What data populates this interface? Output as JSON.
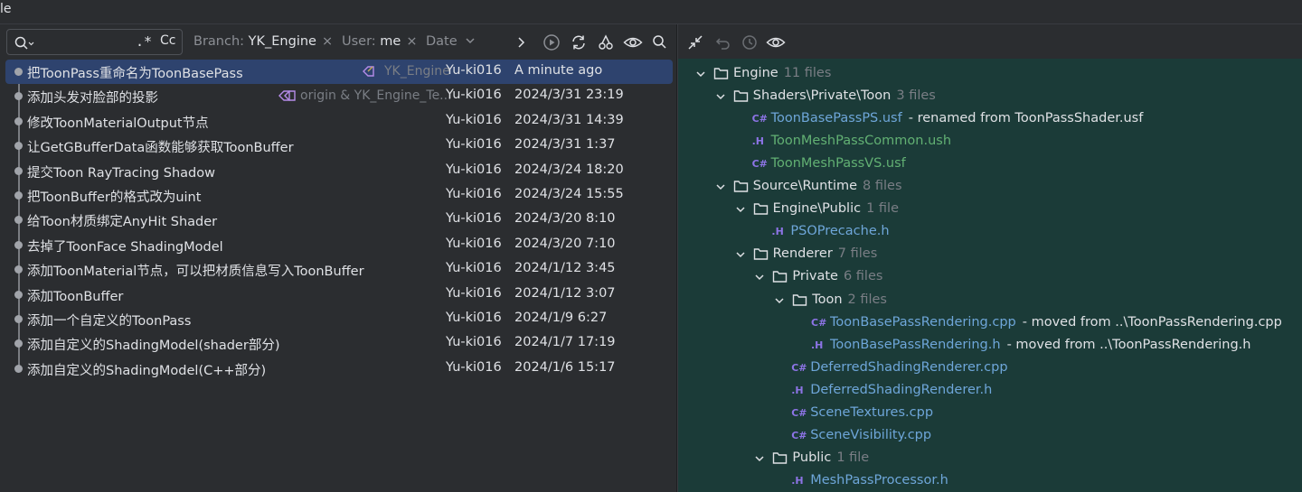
{
  "window": {
    "title": "le"
  },
  "search": {
    "placeholder": "",
    "regex_label": ".*",
    "case_label": "Cc"
  },
  "filters": {
    "branch": {
      "label": "Branch:",
      "value": "YK_Engine",
      "clear": "×"
    },
    "user": {
      "label": "User:",
      "value": "me",
      "clear": "×"
    },
    "date": {
      "label": "Date"
    }
  },
  "commits": [
    {
      "message": "把ToonPass重命名为ToonBasePass",
      "tag": "YK_Engine",
      "author": "Yu-ki016",
      "date": "A minute ago",
      "selected": true
    },
    {
      "message": "添加头发对脸部的投影",
      "tag": "origin & YK_Engine_Te...",
      "author": "Yu-ki016",
      "date": "2024/3/31 23:19"
    },
    {
      "message": "修改ToonMaterialOutput节点",
      "author": "Yu-ki016",
      "date": "2024/3/31 14:39"
    },
    {
      "message": "让GetGBufferData函数能够获取ToonBuffer",
      "author": "Yu-ki016",
      "date": "2024/3/31 1:37"
    },
    {
      "message": "提交Toon RayTracing Shadow",
      "author": "Yu-ki016",
      "date": "2024/3/24 18:20"
    },
    {
      "message": "把ToonBuffer的格式改为uint",
      "author": "Yu-ki016",
      "date": "2024/3/24 15:55"
    },
    {
      "message": "给Toon材质绑定AnyHit Shader",
      "author": "Yu-ki016",
      "date": "2024/3/20 8:10"
    },
    {
      "message": "去掉了ToonFace ShadingModel",
      "author": "Yu-ki016",
      "date": "2024/3/20 7:10"
    },
    {
      "message": "添加ToonMaterial节点，可以把材质信息写入ToonBuffer",
      "author": "Yu-ki016",
      "date": "2024/1/12 3:45"
    },
    {
      "message": "添加ToonBuffer",
      "author": "Yu-ki016",
      "date": "2024/1/12 3:07"
    },
    {
      "message": "添加一个自定义的ToonPass",
      "author": "Yu-ki016",
      "date": "2024/1/9 6:27"
    },
    {
      "message": "添加自定义的ShadingModel(shader部分)",
      "author": "Yu-ki016",
      "date": "2024/1/7 17:19"
    },
    {
      "message": "添加自定义的ShadingModel(C++部分)",
      "author": "Yu-ki016",
      "date": "2024/1/6 15:17"
    }
  ],
  "tree": [
    {
      "type": "folder",
      "name": "Engine",
      "count": "11 files",
      "depth": 0
    },
    {
      "type": "folder",
      "name": "Shaders\\Private\\Toon",
      "count": "3 files",
      "depth": 1
    },
    {
      "type": "file",
      "icon": "C#",
      "name": "ToonBasePassPS.usf",
      "status": "modified",
      "note": "- renamed from ToonPassShader.usf",
      "depth": 2
    },
    {
      "type": "file",
      "icon": ".H",
      "name": "ToonMeshPassCommon.ush",
      "status": "added",
      "depth": 2
    },
    {
      "type": "file",
      "icon": "C#",
      "name": "ToonMeshPassVS.usf",
      "status": "added",
      "depth": 2
    },
    {
      "type": "folder",
      "name": "Source\\Runtime",
      "count": "8 files",
      "depth": 1
    },
    {
      "type": "folder",
      "name": "Engine\\Public",
      "count": "1 file",
      "depth": 2
    },
    {
      "type": "file",
      "icon": ".H",
      "name": "PSOPrecache.h",
      "status": "modified",
      "depth": 3
    },
    {
      "type": "folder",
      "name": "Renderer",
      "count": "7 files",
      "depth": 2
    },
    {
      "type": "folder",
      "name": "Private",
      "count": "6 files",
      "depth": 3
    },
    {
      "type": "folder",
      "name": "Toon",
      "count": "2 files",
      "depth": 4
    },
    {
      "type": "file",
      "icon": "C#",
      "name": "ToonBasePassRendering.cpp",
      "status": "modified",
      "note": "- moved from ..\\ToonPassRendering.cpp",
      "depth": 5
    },
    {
      "type": "file",
      "icon": ".H",
      "name": "ToonBasePassRendering.h",
      "status": "modified",
      "note": "- moved from ..\\ToonPassRendering.h",
      "depth": 5
    },
    {
      "type": "file",
      "icon": "C#",
      "name": "DeferredShadingRenderer.cpp",
      "status": "modified",
      "depth": 4
    },
    {
      "type": "file",
      "icon": ".H",
      "name": "DeferredShadingRenderer.h",
      "status": "modified",
      "depth": 4
    },
    {
      "type": "file",
      "icon": "C#",
      "name": "SceneTextures.cpp",
      "status": "modified",
      "depth": 4
    },
    {
      "type": "file",
      "icon": "C#",
      "name": "SceneVisibility.cpp",
      "status": "modified",
      "depth": 4
    },
    {
      "type": "folder",
      "name": "Public",
      "count": "1 file",
      "depth": 3
    },
    {
      "type": "file",
      "icon": ".H",
      "name": "MeshPassProcessor.h",
      "status": "modified",
      "depth": 4
    }
  ],
  "colors": {
    "selection": "#2e436e",
    "modified": "#6ea6d9",
    "added": "#62b073",
    "diff_panel": "#1b3b38"
  }
}
